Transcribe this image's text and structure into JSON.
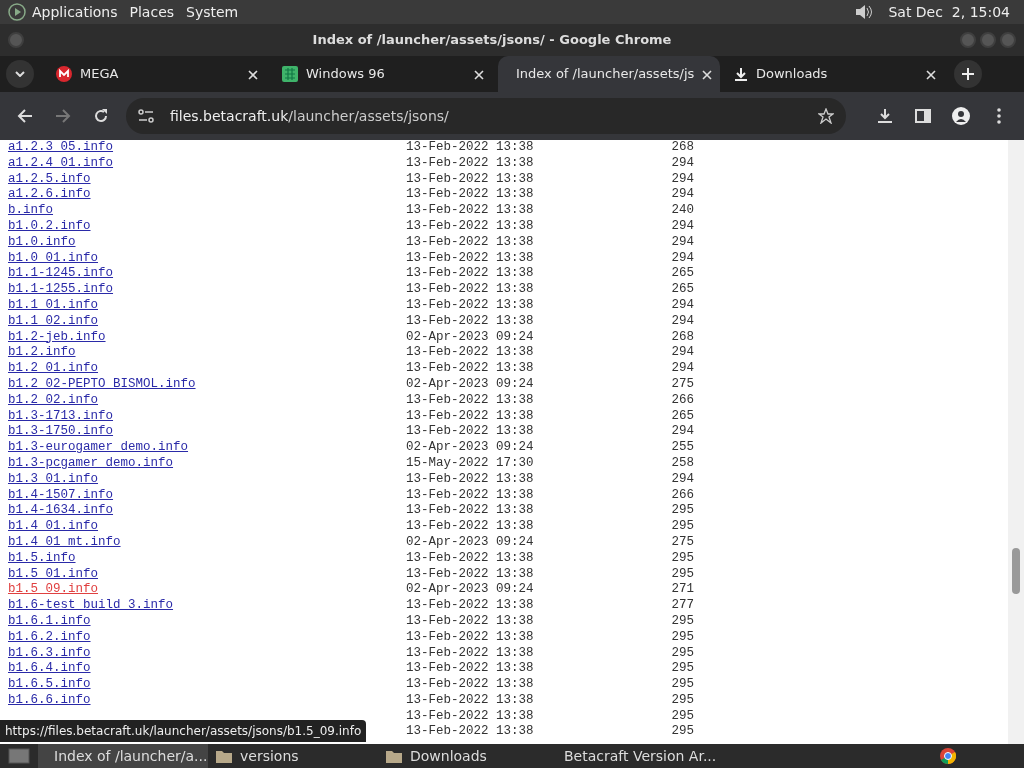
{
  "panel": {
    "menus": [
      "Applications",
      "Places",
      "System"
    ],
    "clock": "Sat Dec  2, 15:04"
  },
  "window": {
    "title": "Index of /launcher/assets/jsons/ - Google Chrome"
  },
  "tabs": [
    {
      "label": "MEGA",
      "selected": false
    },
    {
      "label": "Windows 96",
      "selected": false
    },
    {
      "label": "Index of /launcher/assets/js",
      "selected": true
    },
    {
      "label": "Downloads",
      "selected": false
    }
  ],
  "address": {
    "host": "files.betacraft.uk",
    "path": "/launcher/assets/jsons/"
  },
  "listing": [
    {
      "name": "a1.2.3_05.info",
      "date": "13-Feb-2022 13:38",
      "size": "268",
      "visited": false
    },
    {
      "name": "a1.2.4_01.info",
      "date": "13-Feb-2022 13:38",
      "size": "294",
      "visited": false
    },
    {
      "name": "a1.2.5.info",
      "date": "13-Feb-2022 13:38",
      "size": "294",
      "visited": false
    },
    {
      "name": "a1.2.6.info",
      "date": "13-Feb-2022 13:38",
      "size": "294",
      "visited": false
    },
    {
      "name": "b.info",
      "date": "13-Feb-2022 13:38",
      "size": "240",
      "visited": false
    },
    {
      "name": "b1.0.2.info",
      "date": "13-Feb-2022 13:38",
      "size": "294",
      "visited": false
    },
    {
      "name": "b1.0.info",
      "date": "13-Feb-2022 13:38",
      "size": "294",
      "visited": false
    },
    {
      "name": "b1.0_01.info",
      "date": "13-Feb-2022 13:38",
      "size": "294",
      "visited": false
    },
    {
      "name": "b1.1-1245.info",
      "date": "13-Feb-2022 13:38",
      "size": "265",
      "visited": false
    },
    {
      "name": "b1.1-1255.info",
      "date": "13-Feb-2022 13:38",
      "size": "265",
      "visited": false
    },
    {
      "name": "b1.1_01.info",
      "date": "13-Feb-2022 13:38",
      "size": "294",
      "visited": false
    },
    {
      "name": "b1.1_02.info",
      "date": "13-Feb-2022 13:38",
      "size": "294",
      "visited": false
    },
    {
      "name": "b1.2-jeb.info",
      "date": "02-Apr-2023 09:24",
      "size": "268",
      "visited": false
    },
    {
      "name": "b1.2.info",
      "date": "13-Feb-2022 13:38",
      "size": "294",
      "visited": false
    },
    {
      "name": "b1.2_01.info",
      "date": "13-Feb-2022 13:38",
      "size": "294",
      "visited": false
    },
    {
      "name": "b1.2_02-PEPTO_BISMOL.info",
      "date": "02-Apr-2023 09:24",
      "size": "275",
      "visited": false
    },
    {
      "name": "b1.2_02.info",
      "date": "13-Feb-2022 13:38",
      "size": "266",
      "visited": false
    },
    {
      "name": "b1.3-1713.info",
      "date": "13-Feb-2022 13:38",
      "size": "265",
      "visited": false
    },
    {
      "name": "b1.3-1750.info",
      "date": "13-Feb-2022 13:38",
      "size": "294",
      "visited": false
    },
    {
      "name": "b1.3-eurogamer_demo.info",
      "date": "02-Apr-2023 09:24",
      "size": "255",
      "visited": false
    },
    {
      "name": "b1.3-pcgamer_demo.info",
      "date": "15-May-2022 17:30",
      "size": "258",
      "visited": false
    },
    {
      "name": "b1.3_01.info",
      "date": "13-Feb-2022 13:38",
      "size": "294",
      "visited": false
    },
    {
      "name": "b1.4-1507.info",
      "date": "13-Feb-2022 13:38",
      "size": "266",
      "visited": false
    },
    {
      "name": "b1.4-1634.info",
      "date": "13-Feb-2022 13:38",
      "size": "295",
      "visited": false
    },
    {
      "name": "b1.4_01.info",
      "date": "13-Feb-2022 13:38",
      "size": "295",
      "visited": false
    },
    {
      "name": "b1.4_01_mt.info",
      "date": "02-Apr-2023 09:24",
      "size": "275",
      "visited": false
    },
    {
      "name": "b1.5.info",
      "date": "13-Feb-2022 13:38",
      "size": "295",
      "visited": false
    },
    {
      "name": "b1.5_01.info",
      "date": "13-Feb-2022 13:38",
      "size": "295",
      "visited": false
    },
    {
      "name": "b1.5_09.info",
      "date": "02-Apr-2023 09:24",
      "size": "271",
      "visited": true
    },
    {
      "name": "b1.6-test_build_3.info",
      "date": "13-Feb-2022 13:38",
      "size": "277",
      "visited": false
    },
    {
      "name": "b1.6.1.info",
      "date": "13-Feb-2022 13:38",
      "size": "295",
      "visited": false
    },
    {
      "name": "b1.6.2.info",
      "date": "13-Feb-2022 13:38",
      "size": "295",
      "visited": false
    },
    {
      "name": "b1.6.3.info",
      "date": "13-Feb-2022 13:38",
      "size": "295",
      "visited": false
    },
    {
      "name": "b1.6.4.info",
      "date": "13-Feb-2022 13:38",
      "size": "295",
      "visited": false
    },
    {
      "name": "b1.6.5.info",
      "date": "13-Feb-2022 13:38",
      "size": "295",
      "visited": false
    },
    {
      "name": "b1.6.6.info",
      "date": "13-Feb-2022 13:38",
      "size": "295",
      "visited": false
    },
    {
      "date": "13-Feb-2022 13:38",
      "size": "295"
    },
    {
      "date": "13-Feb-2022 13:38",
      "size": "295"
    }
  ],
  "status_url": "https://files.betacraft.uk/launcher/assets/jsons/b1.5_09.info",
  "taskbar": [
    {
      "label": "Index of /launcher/a...",
      "selected": true
    },
    {
      "label": "versions",
      "selected": false
    },
    {
      "label": "Downloads",
      "selected": false
    },
    {
      "label": "Betacraft Version Ar...",
      "selected": false
    }
  ]
}
